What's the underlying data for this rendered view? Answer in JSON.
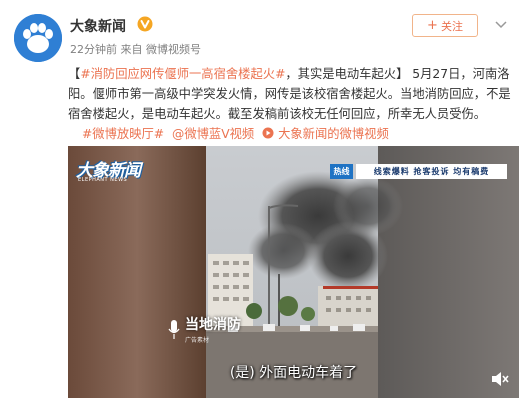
{
  "post": {
    "author": "大象新闻",
    "time": "22分钟前",
    "source_prefix": "来自",
    "source": "微博视频号",
    "follow_label": "关注",
    "hashtag_title": "#消防回应网传偃师一高宿舍楼起火#",
    "headline_rest": "，其实是电动车起火",
    "bracket_close": "】",
    "bracket_open": "【",
    "body": "5月27日，河南洛阳。偃师市第一高级中学突发火情，网传是该校宿舍楼起火。当地消防回应，不是宿舍楼起火，是电动车起火。截至发稿前该校无任何回应，所幸无人员受伤。",
    "tag_1": "#微博放映厅#",
    "tag_2": "@微博蓝V视频",
    "tag_3": "大象新闻的微博视频"
  },
  "video": {
    "logo": "大象新闻",
    "logo_sub": "ELEPHANT NEWS",
    "hotline_badge": "热线",
    "hotline_text": "线索爆料  抢客投诉  均有稿费",
    "source_name": "当地消防",
    "source_sub": "广告素材",
    "subtitle": "(是) 外面电动车着了"
  },
  "colors": {
    "accent": "#eb7350",
    "link": "#eb7350",
    "brand_blue": "#2f7fd4",
    "verified": "#f5a623"
  }
}
